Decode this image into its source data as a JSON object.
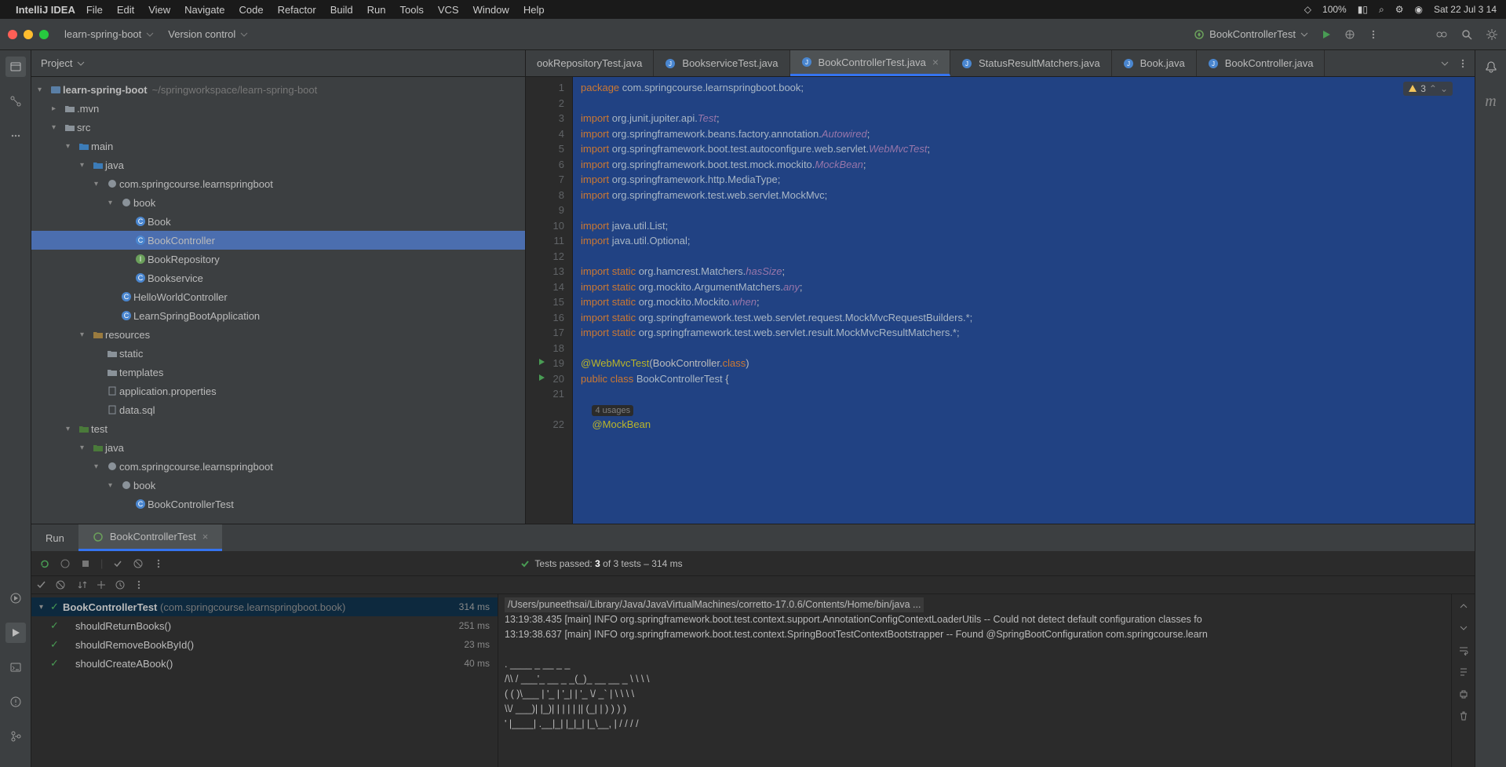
{
  "macos": {
    "app_name": "IntelliJ IDEA",
    "menu": [
      "File",
      "Edit",
      "View",
      "Navigate",
      "Code",
      "Refactor",
      "Build",
      "Run",
      "Tools",
      "VCS",
      "Window",
      "Help"
    ],
    "battery": "100%",
    "datetime": "Sat 22 Jul  3 14"
  },
  "titlebar": {
    "project": "learn-spring-boot",
    "vcs": "Version control"
  },
  "run_config": {
    "name": "BookControllerTest"
  },
  "project_panel": {
    "title": "Project",
    "tree": [
      {
        "depth": 0,
        "arrow": "▾",
        "icon": "module",
        "label": "learn-spring-boot",
        "hint": "~/springworkspace/learn-spring-boot",
        "bold": true
      },
      {
        "depth": 1,
        "arrow": "▸",
        "icon": "folder",
        "label": ".mvn"
      },
      {
        "depth": 1,
        "arrow": "▾",
        "icon": "folder",
        "label": "src"
      },
      {
        "depth": 2,
        "arrow": "▾",
        "icon": "src",
        "label": "main"
      },
      {
        "depth": 3,
        "arrow": "▾",
        "icon": "src",
        "label": "java"
      },
      {
        "depth": 4,
        "arrow": "▾",
        "icon": "pkg",
        "label": "com.springcourse.learnspringboot"
      },
      {
        "depth": 5,
        "arrow": "▾",
        "icon": "pkg",
        "label": "book"
      },
      {
        "depth": 6,
        "arrow": "",
        "icon": "class",
        "label": "Book"
      },
      {
        "depth": 6,
        "arrow": "",
        "icon": "class",
        "label": "BookController",
        "highlighted": true
      },
      {
        "depth": 6,
        "arrow": "",
        "icon": "interface",
        "label": "BookRepository"
      },
      {
        "depth": 6,
        "arrow": "",
        "icon": "class",
        "label": "Bookservice"
      },
      {
        "depth": 5,
        "arrow": "",
        "icon": "class",
        "label": "HelloWorldController"
      },
      {
        "depth": 5,
        "arrow": "",
        "icon": "class",
        "label": "LearnSpringBootApplication"
      },
      {
        "depth": 3,
        "arrow": "▾",
        "icon": "res",
        "label": "resources"
      },
      {
        "depth": 4,
        "arrow": "",
        "icon": "folder",
        "label": "static"
      },
      {
        "depth": 4,
        "arrow": "",
        "icon": "folder",
        "label": "templates"
      },
      {
        "depth": 4,
        "arrow": "",
        "icon": "file",
        "label": "application.properties"
      },
      {
        "depth": 4,
        "arrow": "",
        "icon": "file",
        "label": "data.sql"
      },
      {
        "depth": 2,
        "arrow": "▾",
        "icon": "test",
        "label": "test"
      },
      {
        "depth": 3,
        "arrow": "▾",
        "icon": "test",
        "label": "java"
      },
      {
        "depth": 4,
        "arrow": "▾",
        "icon": "pkg",
        "label": "com.springcourse.learnspringboot"
      },
      {
        "depth": 5,
        "arrow": "▾",
        "icon": "pkg",
        "label": "book"
      },
      {
        "depth": 6,
        "arrow": "",
        "icon": "class",
        "label": "BookControllerTest",
        "cut": true
      }
    ]
  },
  "tabs": [
    {
      "label": "ookRepositoryTest.java",
      "active": false,
      "partial": true,
      "close": false
    },
    {
      "label": "BookserviceTest.java",
      "active": false
    },
    {
      "label": "BookControllerTest.java",
      "active": true,
      "close": true
    },
    {
      "label": "StatusResultMatchers.java",
      "active": false
    },
    {
      "label": "Book.java",
      "active": false
    },
    {
      "label": "BookController.java",
      "active": false
    }
  ],
  "inspection": {
    "warnings": "3"
  },
  "code": {
    "lines": [
      {
        "n": 1,
        "html": "<span class='kw'>package</span> <span class='pkg'>com.springcourse.learnspringboot.book;</span>"
      },
      {
        "n": 2,
        "html": ""
      },
      {
        "n": 3,
        "html": "<span class='kw'>import</span> <span class='pkg'>org.junit.jupiter.api.</span><span class='id'>Test</span>;"
      },
      {
        "n": 4,
        "html": "<span class='kw'>import</span> <span class='pkg'>org.springframework.beans.factory.annotation.</span><span class='id'>Autowired</span>;"
      },
      {
        "n": 5,
        "html": "<span class='kw'>import</span> <span class='pkg'>org.springframework.boot.test.autoconfigure.web.servlet.</span><span class='id'>WebMvcTest</span>;"
      },
      {
        "n": 6,
        "html": "<span class='kw'>import</span> <span class='pkg'>org.springframework.boot.test.mock.mockito.</span><span class='id'>MockBean</span>;"
      },
      {
        "n": 7,
        "html": "<span class='kw'>import</span> <span class='pkg'>org.springframework.http.MediaType;</span>"
      },
      {
        "n": 8,
        "html": "<span class='kw'>import</span> <span class='pkg'>org.springframework.test.web.servlet.MockMvc;</span>"
      },
      {
        "n": 9,
        "html": ""
      },
      {
        "n": 10,
        "html": "<span class='kw'>import</span> <span class='pkg'>java.util.List;</span>"
      },
      {
        "n": 11,
        "html": "<span class='kw'>import</span> <span class='pkg'>java.util.Optional;</span>"
      },
      {
        "n": 12,
        "html": ""
      },
      {
        "n": 13,
        "html": "<span class='kw'>import static</span> <span class='pkg'>org.hamcrest.Matchers.</span><span class='id'>hasSize</span>;"
      },
      {
        "n": 14,
        "html": "<span class='kw'>import static</span> <span class='pkg'>org.mockito.ArgumentMatchers.</span><span class='id'>any</span>;"
      },
      {
        "n": 15,
        "html": "<span class='kw'>import static</span> <span class='pkg'>org.mockito.Mockito.</span><span class='id'>when</span>;"
      },
      {
        "n": 16,
        "html": "<span class='kw'>import static</span> <span class='pkg'>org.springframework.test.web.servlet.request.MockMvcRequestBuilders.*;</span>"
      },
      {
        "n": 17,
        "html": "<span class='kw'>import static</span> <span class='pkg'>org.springframework.test.web.servlet.result.MockMvcResultMatchers.*;</span>"
      },
      {
        "n": 18,
        "html": ""
      },
      {
        "n": 19,
        "html": "<span class='ann'>@WebMvcTest</span>(BookController.<span class='kw'>class</span>)",
        "runIcon": true
      },
      {
        "n": 20,
        "html": "<span class='kw'>public class</span> <span class='cls'>BookControllerTest</span> {",
        "runIcon": true
      },
      {
        "n": 21,
        "html": ""
      },
      {
        "n": "",
        "html": "    <span class='usages'>4 usages</span>"
      },
      {
        "n": 22,
        "html": "    <span class='ann'>@MockBean</span>"
      }
    ]
  },
  "run": {
    "tab_label": "Run",
    "config_label": "BookControllerTest",
    "summary_pass": "Tests passed:",
    "summary_count": "3",
    "summary_of": "of",
    "summary_total": "3 tests",
    "summary_dash": "–",
    "summary_time": "314 ms",
    "tests": [
      {
        "name": "BookControllerTest",
        "hint": "(com.springcourse.learnspringboot.book)",
        "time": "314 ms",
        "root": true,
        "selected": true
      },
      {
        "name": "shouldReturnBooks()",
        "time": "251 ms"
      },
      {
        "name": "shouldRemoveBookById()",
        "time": "23 ms"
      },
      {
        "name": "shouldCreateABook()",
        "time": "40 ms"
      }
    ],
    "console": [
      {
        "cls": "cmd-line",
        "text": "/Users/puneethsai/Library/Java/JavaVirtualMachines/corretto-17.0.6/Contents/Home/bin/java ..."
      },
      {
        "text": "13:19:38.435 [main] INFO org.springframework.boot.test.context.support.AnnotationConfigContextLoaderUtils -- Could not detect default configuration classes fo"
      },
      {
        "text": "13:19:38.637 [main] INFO org.springframework.boot.test.context.SpringBootTestContextBootstrapper -- Found @SpringBootConfiguration com.springcourse.learn"
      },
      {
        "text": ""
      },
      {
        "text": "  .   ____          _            __ _ _"
      },
      {
        "text": " /\\\\ / ___'_ __ _ _(_)_ __  __ _ \\ \\ \\ \\"
      },
      {
        "text": "( ( )\\___ | '_ | '_| | '_ \\/ _` | \\ \\ \\ \\"
      },
      {
        "text": " \\\\/  ___)| |_)| | | | | || (_| |  ) ) ) )"
      },
      {
        "text": "  '  |____| .__|_| |_|_| |_\\__, | / / / /"
      }
    ]
  }
}
